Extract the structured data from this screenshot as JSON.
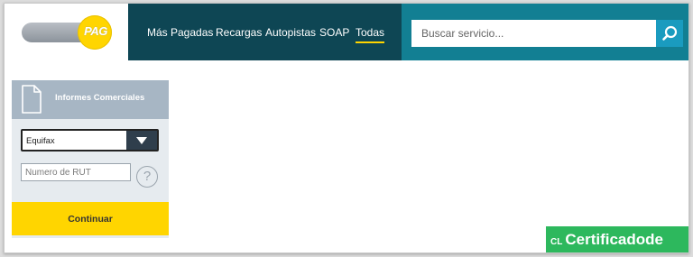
{
  "header": {
    "logo_text": "PAG",
    "nav": [
      "Más Pagadas",
      "Recargas",
      "Autopistas",
      "SOAP",
      "Todas"
    ],
    "search_placeholder": "Buscar servicio..."
  },
  "sidebar": {
    "title": "Informes Comerciales",
    "select_value": "Equifax",
    "rut_placeholder": "Numero de RUT",
    "help_symbol": "?",
    "continue_label": "Continuar"
  },
  "watermark": {
    "prefix": "CL",
    "text": "Certificadode"
  },
  "colors": {
    "nav_bg": "#0e4654",
    "search_bg": "#127f93",
    "search_button": "#1a9bbf",
    "accent_yellow": "#ffd500",
    "sidebar_header": "#a7b6c4",
    "watermark_green": "#2db85d"
  },
  "icons": [
    "search-icon",
    "document-icon",
    "chevron-down-icon",
    "help-icon"
  ]
}
